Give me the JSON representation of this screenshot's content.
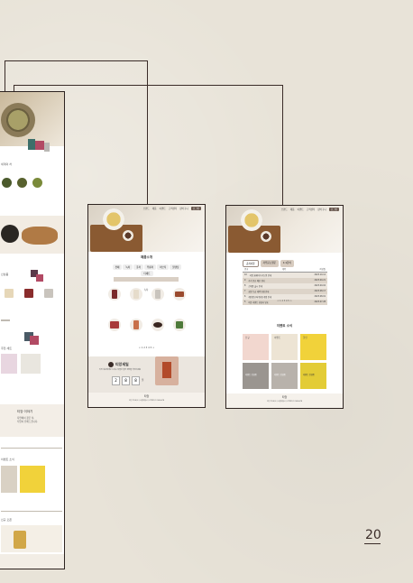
{
  "page": {
    "number": "20"
  },
  "left_frame": {
    "hero": {
      "alt": "tea strainer hero"
    },
    "sections": [
      {
        "label": "세계의 차"
      },
      {
        "label": "신상품"
      },
      {
        "label": "추천 세트"
      },
      {
        "label": "티앙 이야기",
        "line1": "자연에서 찾은 차,",
        "line2": "티앙이 전해드립니다."
      },
      {
        "label": "이벤트 소식"
      },
      {
        "label": "신규 오픈"
      }
    ]
  },
  "mid_frame": {
    "nav": [
      "브랜드",
      "제품",
      "이벤트",
      "고객센터",
      "장바구니"
    ],
    "nav_button": "로그인",
    "section_title": "제품소개",
    "tabs": [
      "전체",
      "녹차",
      "홍차",
      "우롱차",
      "허브티",
      "블렌딩",
      "티세트"
    ],
    "tab_active": "녹차",
    "pagination": "< 1 2 3 4 5 >",
    "brand_title": "티앙세일",
    "brand_sub": "티앙 회원에게만 드리는 특별한 할인 혜택을 확인하세요",
    "countdown": [
      "2",
      "8",
      "8"
    ],
    "countdown_label": "일",
    "footer_logo": "티앙",
    "footer_text": "티앙 주식회사 | 서울특별시 | 고객센터 1234-5678"
  },
  "right_frame": {
    "nav": [
      "브랜드",
      "제품",
      "이벤트",
      "고객센터",
      "장바구니"
    ],
    "nav_button": "로그인",
    "tabs": [
      "공지사항",
      "자주묻는질문",
      "1:1문의"
    ],
    "table_headers": [
      "번호",
      "제목",
      "작성일"
    ],
    "rows": [
      {
        "no": "10",
        "title": "티앙 홈페이지 리뉴얼 안내",
        "date": "2023.10.12"
      },
      {
        "no": "9",
        "title": "추석 연휴 배송 안내",
        "date": "2023.09.21"
      },
      {
        "no": "8",
        "title": "신제품 출시 안내",
        "date": "2023.09.02"
      },
      {
        "no": "7",
        "title": "회원 등급 혜택 변경 안내",
        "date": "2023.08.17"
      },
      {
        "no": "6",
        "title": "개인정보처리방침 개정 안내",
        "date": "2023.08.01"
      },
      {
        "no": "5",
        "title": "여름 이벤트 당첨자 발표",
        "date": "2023.07.28"
      }
    ],
    "pagination": "< 1 2 3 4 5 >",
    "event_title": "이벤트 소식",
    "event_cards": [
      {
        "label": "신규",
        "color": "#f2d7cf"
      },
      {
        "label": "이벤트",
        "color": "#ede4d4"
      },
      {
        "label": "할인",
        "color": "#f1d23a"
      },
      {
        "label": "이벤트 진행중",
        "color": "#9a9590"
      },
      {
        "label": "이벤트 진행중",
        "color": "#b8b2ab"
      },
      {
        "label": "이벤트 진행중",
        "color": "#e3cc36"
      }
    ],
    "footer_logo": "티앙",
    "footer_text": "티앙 주식회사 | 서울특별시 | 고객센터 1234-5678"
  }
}
